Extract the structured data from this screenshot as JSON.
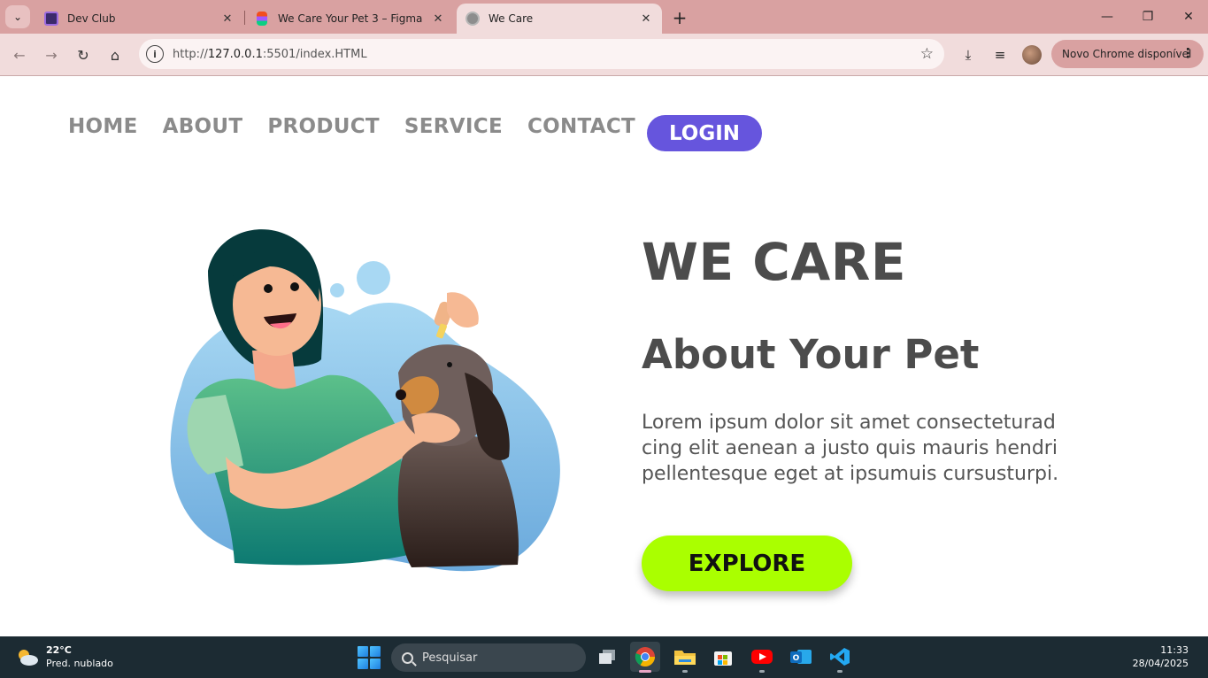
{
  "browser": {
    "tabs": [
      {
        "label": "Dev Club",
        "active": false,
        "favicon": "devclub-icon"
      },
      {
        "label": "We Care Your Pet 3 – Figma",
        "active": false,
        "favicon": "figma-icon"
      },
      {
        "label": "We Care",
        "active": true,
        "favicon": "globe-icon"
      }
    ],
    "url_scheme": "http://",
    "url_host": "127.0.0.1",
    "url_rest": ":5501/index.HTML",
    "update_label": "Novo Chrome disponível"
  },
  "page": {
    "nav": [
      "HOME",
      "ABOUT",
      "PRODUCT",
      "SERVICE",
      "CONTACT"
    ],
    "login_label": "LOGIN",
    "title": "WE CARE",
    "subtitle": "About Your Pet",
    "body_lines": [
      "Lorem ipsum dolor sit amet consecteturad",
      "cing elit aenean a justo quis mauris hendri",
      "pellentesque eget at ipsumuis cursusturpi."
    ],
    "explore_label": "EXPLORE",
    "colors": {
      "login": "#6655dd",
      "explore": "#aaff00",
      "heading": "#4c4c4c",
      "nav": "#8b8b8b"
    }
  },
  "taskbar": {
    "temp": "22°C",
    "weather": "Pred. nublado",
    "search_placeholder": "Pesquisar",
    "time": "11:33",
    "date": "28/04/2025",
    "apps": [
      "task-view-icon",
      "chrome-icon",
      "file-explorer-icon",
      "store-icon",
      "youtube-icon",
      "outlook-icon",
      "vscode-icon"
    ]
  }
}
